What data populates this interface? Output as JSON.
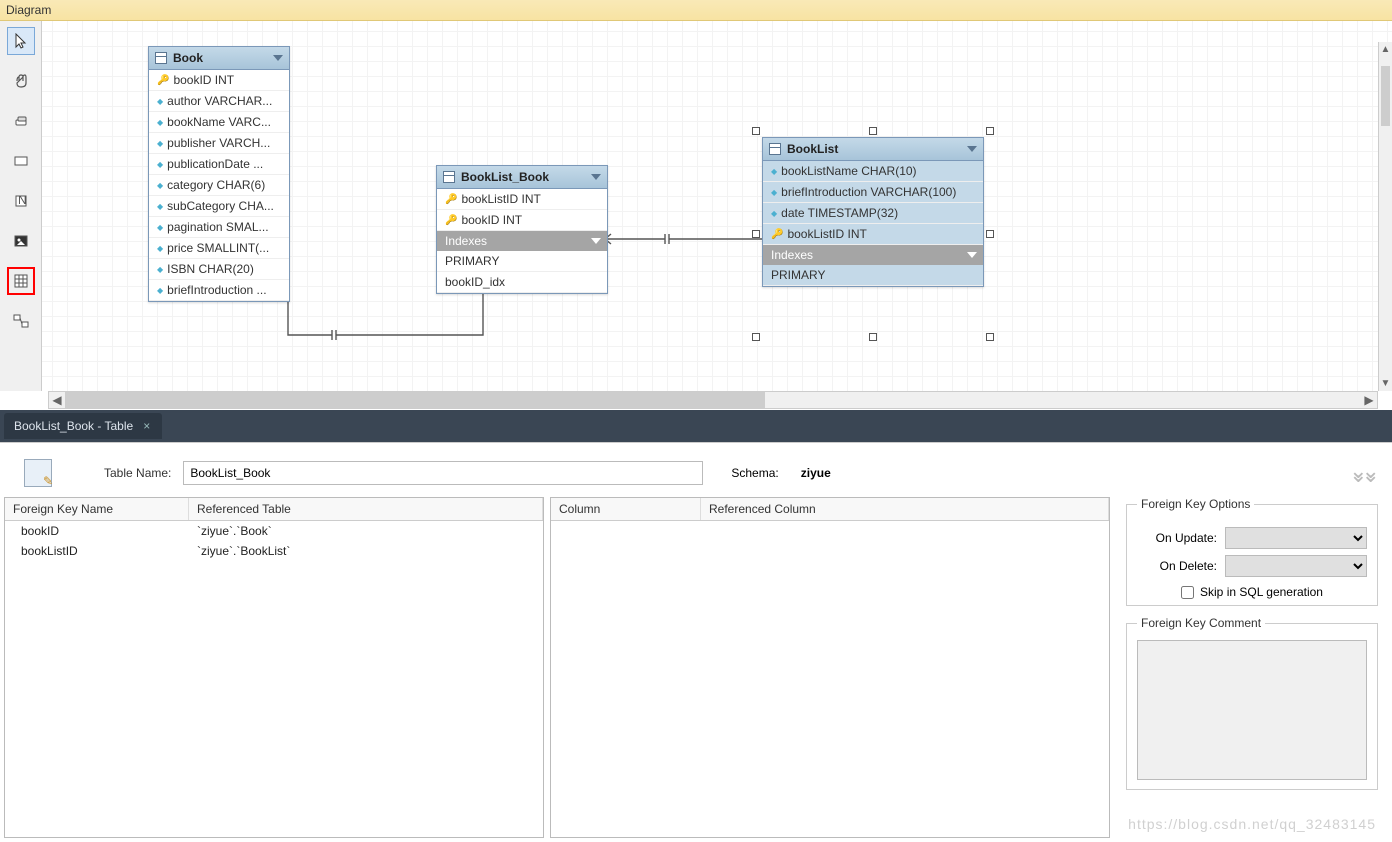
{
  "header": {
    "title": "Diagram"
  },
  "tables": {
    "book": {
      "name": "Book",
      "columns": [
        {
          "icon": "key",
          "text": "bookID INT"
        },
        {
          "icon": "diamond",
          "text": "author VARCHAR..."
        },
        {
          "icon": "diamond",
          "text": "bookName VARC..."
        },
        {
          "icon": "diamond",
          "text": "publisher VARCH..."
        },
        {
          "icon": "diamond",
          "text": "publicationDate ..."
        },
        {
          "icon": "diamond",
          "text": "category CHAR(6)"
        },
        {
          "icon": "diamond",
          "text": "subCategory CHA..."
        },
        {
          "icon": "diamond",
          "text": "pagination SMAL..."
        },
        {
          "icon": "diamond",
          "text": "price SMALLINT(..."
        },
        {
          "icon": "diamond",
          "text": "ISBN CHAR(20)"
        },
        {
          "icon": "diamond",
          "text": "briefIntroduction ..."
        }
      ]
    },
    "booklist_book": {
      "name": "BookList_Book",
      "columns": [
        {
          "icon": "rkey",
          "text": "bookListID INT"
        },
        {
          "icon": "rkey",
          "text": "bookID INT"
        }
      ],
      "indexes_label": "Indexes",
      "indexes": [
        "PRIMARY",
        "bookID_idx"
      ]
    },
    "booklist": {
      "name": "BookList",
      "columns": [
        {
          "icon": "diamond",
          "text": "bookListName CHAR(10)"
        },
        {
          "icon": "diamond",
          "text": "briefIntroduction VARCHAR(100)"
        },
        {
          "icon": "diamond",
          "text": "date TIMESTAMP(32)"
        },
        {
          "icon": "key",
          "text": "bookListID INT"
        }
      ],
      "indexes_label": "Indexes",
      "indexes": [
        "PRIMARY"
      ]
    }
  },
  "bottom_tab": {
    "title": "BookList_Book - Table"
  },
  "editor": {
    "table_name_label": "Table Name:",
    "table_name_value": "BookList_Book",
    "schema_label": "Schema:",
    "schema_value": "ziyue",
    "fk_grid": {
      "h1": "Foreign Key Name",
      "h2": "Referenced Table",
      "rows": [
        {
          "name": "bookID",
          "ref": "`ziyue`.`Book`"
        },
        {
          "name": "bookListID",
          "ref": "`ziyue`.`BookList`"
        }
      ]
    },
    "col_grid": {
      "h1": "Column",
      "h2": "Referenced Column"
    },
    "options": {
      "legend": "Foreign Key Options",
      "on_update": "On Update:",
      "on_delete": "On Delete:",
      "skip_label": "Skip in SQL generation"
    },
    "comment_legend": "Foreign Key Comment"
  },
  "watermark": "https://blog.csdn.net/qq_32483145"
}
